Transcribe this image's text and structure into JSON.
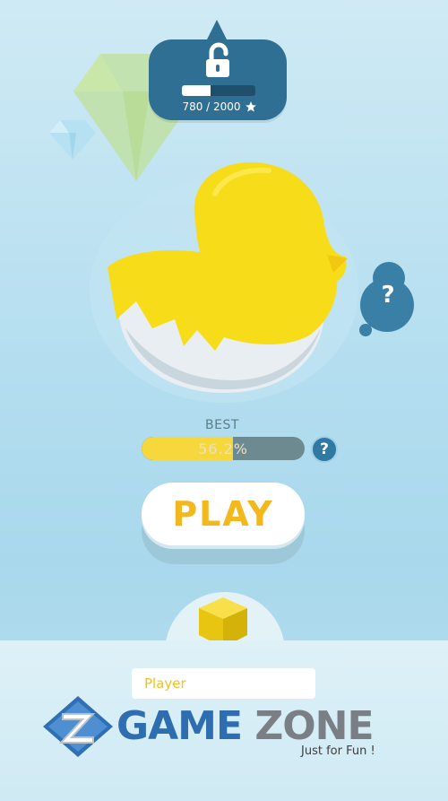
{
  "colors": {
    "accent_yellow": "#f6d83c",
    "play_text": "#f3b81e",
    "badge_blue": "#2e6f93",
    "logo_blue": "#2d6db0",
    "logo_gray": "#7a7f86"
  },
  "unlock": {
    "icon": "unlocked-padlock-icon",
    "current": 780,
    "target": 2000,
    "text": "780 / 2000",
    "progress_fraction": 0.39
  },
  "character": {
    "name": "yellow-duck-hatching-from-egg",
    "hint_icon": "question-mark-icon",
    "hint_text": "?"
  },
  "best": {
    "label": "BEST",
    "value_text": "56.2%",
    "progress_fraction": 0.562,
    "help_text": "?"
  },
  "play_button": {
    "label": "PLAY"
  },
  "skin": {
    "icon": "yellow-cube-icon"
  },
  "player": {
    "name": "Player"
  },
  "watermark": {
    "logo": "game-zone-logo",
    "word1": "GAME",
    "word2": "ZONE",
    "tagline": "Just for Fun !"
  }
}
